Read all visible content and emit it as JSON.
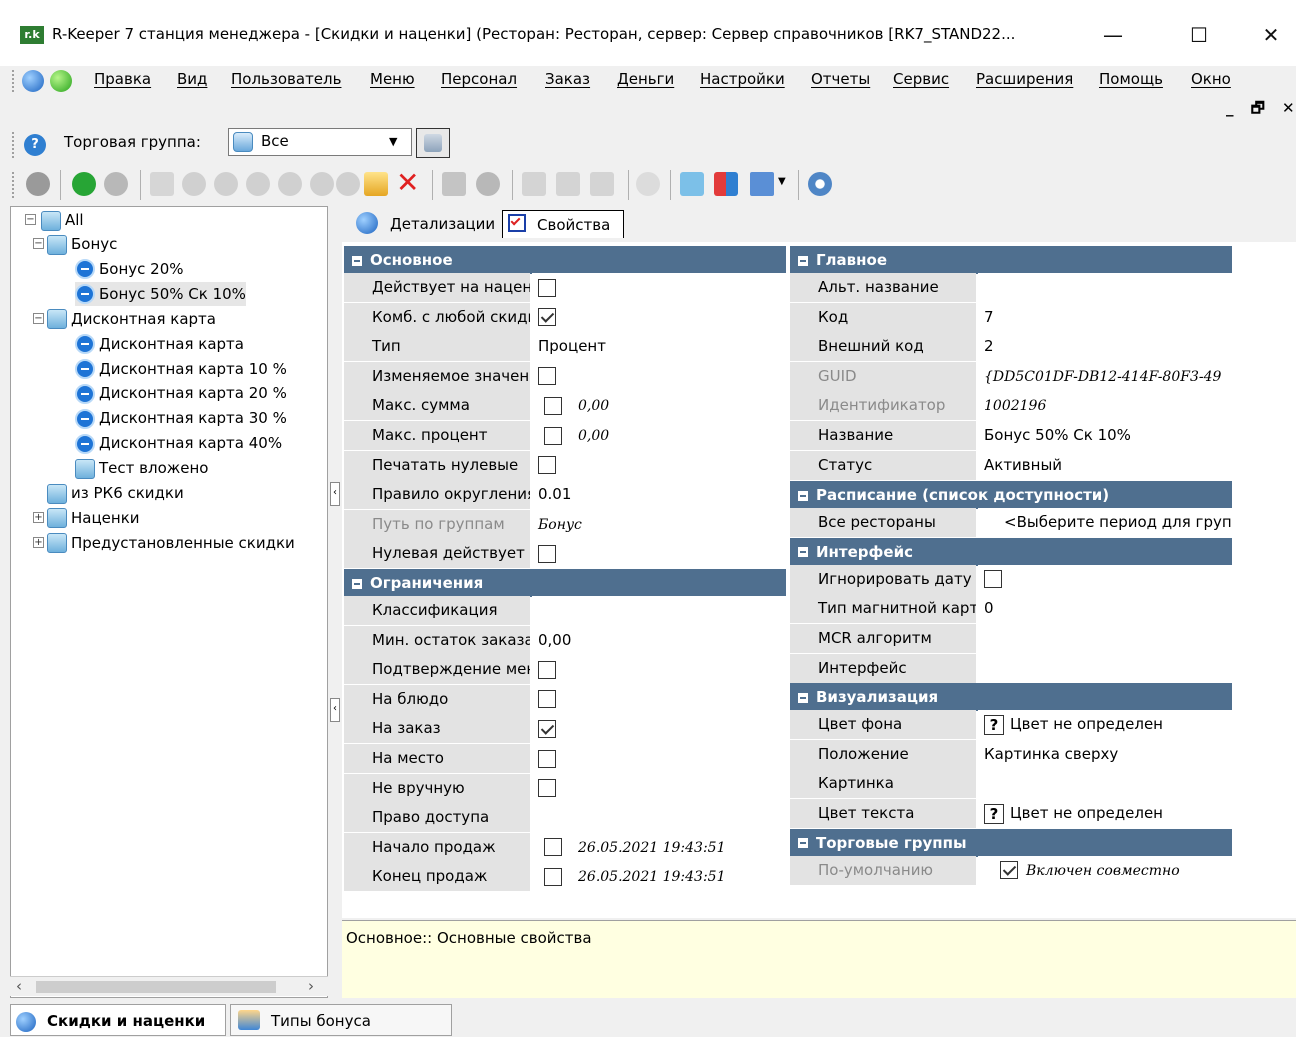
{
  "window": {
    "title": "R-Keeper 7 станция менеджера - [Скидки и наценки] (Ресторан: Ресторан, сервер: Сервер справочников [RK7_STAND22...",
    "logo_text": "r.k",
    "minimize": "—",
    "maximize": "☐",
    "close": "✕"
  },
  "menu": {
    "items": [
      "Правка",
      "Вид",
      "Пользователь",
      "Меню",
      "Персонал",
      "Заказ",
      "Деньги",
      "Настройки",
      "Отчеты",
      "Сервис",
      "Расширения",
      "Помощь",
      "Окно"
    ],
    "child_controls": "_ 🗗 ✕"
  },
  "group_bar": {
    "label": "Торговая группа:",
    "selected": "Все"
  },
  "tree": {
    "root": "All",
    "items": [
      {
        "label": "Бонус",
        "type": "folder"
      },
      {
        "label": "Бонус 20%",
        "type": "disc"
      },
      {
        "label": "Бонус 50% Ск 10%",
        "type": "disc"
      },
      {
        "label": "Дисконтная карта",
        "type": "folder"
      },
      {
        "label": "Дисконтная карта",
        "type": "disc"
      },
      {
        "label": "Дисконтная карта 10 %",
        "type": "disc"
      },
      {
        "label": "Дисконтная карта 20 %",
        "type": "disc"
      },
      {
        "label": "Дисконтная карта 30 %",
        "type": "disc"
      },
      {
        "label": "Дисконтная карта 40%",
        "type": "disc"
      },
      {
        "label": "Тест вложено",
        "type": "folder"
      },
      {
        "label": "из РК6 скидки",
        "type": "folder"
      },
      {
        "label": "Наценки",
        "type": "folder"
      },
      {
        "label": "Предустановленные скидки",
        "type": "folder"
      }
    ]
  },
  "tabs": {
    "details": "Детализации",
    "properties": "Свойства"
  },
  "left_grid": {
    "sec_main": "Основное",
    "main_rows": [
      {
        "name": "Действует на наценку",
        "type": "check",
        "checked": false
      },
      {
        "name": "Комб. с любой скидкой",
        "type": "check",
        "checked": true
      },
      {
        "name": "Тип",
        "type": "text",
        "value": "Процент"
      },
      {
        "name": "Изменяемое значение",
        "type": "check",
        "checked": false
      },
      {
        "name": "Макс. сумма",
        "type": "checkval",
        "checked": false,
        "value": "0,00"
      },
      {
        "name": "Макс. процент",
        "type": "checkval",
        "checked": false,
        "value": "0,00"
      },
      {
        "name": "Печатать нулевые",
        "type": "check",
        "checked": false
      },
      {
        "name": "Правило округления",
        "type": "text",
        "value": "0.01"
      },
      {
        "name": "Путь по группам",
        "type": "dimtext",
        "value": "Бонус"
      },
      {
        "name": "Нулевая действует",
        "type": "check",
        "checked": false
      }
    ],
    "sec_limits": "Ограничения",
    "limit_rows": [
      {
        "name": "Классификация",
        "type": "text",
        "value": ""
      },
      {
        "name": "Мин. остаток заказа",
        "type": "text",
        "value": "0,00"
      },
      {
        "name": "Подтверждение менеджером",
        "type": "check",
        "checked": false
      },
      {
        "name": "На блюдо",
        "type": "check",
        "checked": false
      },
      {
        "name": "На заказ",
        "type": "check",
        "checked": true
      },
      {
        "name": "На место",
        "type": "check",
        "checked": false
      },
      {
        "name": "Не вручную",
        "type": "check",
        "checked": false
      },
      {
        "name": "Право доступа",
        "type": "text",
        "value": ""
      },
      {
        "name": "Начало продаж",
        "type": "checkval",
        "checked": false,
        "value": "26.05.2021 19:43:51"
      },
      {
        "name": "Конец продаж",
        "type": "checkval",
        "checked": false,
        "value": "26.05.2021 19:43:51"
      }
    ]
  },
  "right_grid": {
    "sec_main": "Главное",
    "main_rows": [
      {
        "name": "Альт. название",
        "value": ""
      },
      {
        "name": "Код",
        "value": "7"
      },
      {
        "name": "Внешний код",
        "value": "2"
      },
      {
        "name": "GUID",
        "value": "{DD5C01DF-DB12-414F-80F3-49",
        "dim": true
      },
      {
        "name": "Идентификатор",
        "value": "1002196",
        "dim": true
      },
      {
        "name": "Название",
        "value": "Бонус 50% Ск 10%"
      },
      {
        "name": "Статус",
        "value": "Активный"
      }
    ],
    "sec_schedule": "Расписание (список доступности)",
    "schedule_row": {
      "name": "Все рестораны",
      "value": "<Выберите период для групп"
    },
    "sec_interface": "Интерфейс",
    "interface_rows": [
      {
        "name": "Игнорировать дату",
        "type": "check",
        "checked": false
      },
      {
        "name": "Тип магнитной карты",
        "value": "0"
      },
      {
        "name": "MCR алгоритм",
        "value": ""
      },
      {
        "name": "Интерфейс",
        "value": ""
      }
    ],
    "sec_visual": "Визуализация",
    "visual_rows": [
      {
        "name": "Цвет фона",
        "value": "Цвет не определен",
        "q": true
      },
      {
        "name": "Положение",
        "value": "Картинка сверху"
      },
      {
        "name": "Картинка",
        "value": ""
      },
      {
        "name": "Цвет текста",
        "value": "Цвет не определен",
        "q": true
      }
    ],
    "sec_trade": "Торговые группы",
    "trade_row": {
      "name": "По-умолчанию",
      "value": "Включен совместно",
      "checked": true
    }
  },
  "description": "Основное:: Основные свойства",
  "status_tabs": {
    "active": "Скидки и наценки",
    "other": "Типы бонуса"
  },
  "colors": {
    "section": "#4f6f8f",
    "name_cell": "#e3e3e3",
    "desc_bg": "#ffffe1"
  }
}
